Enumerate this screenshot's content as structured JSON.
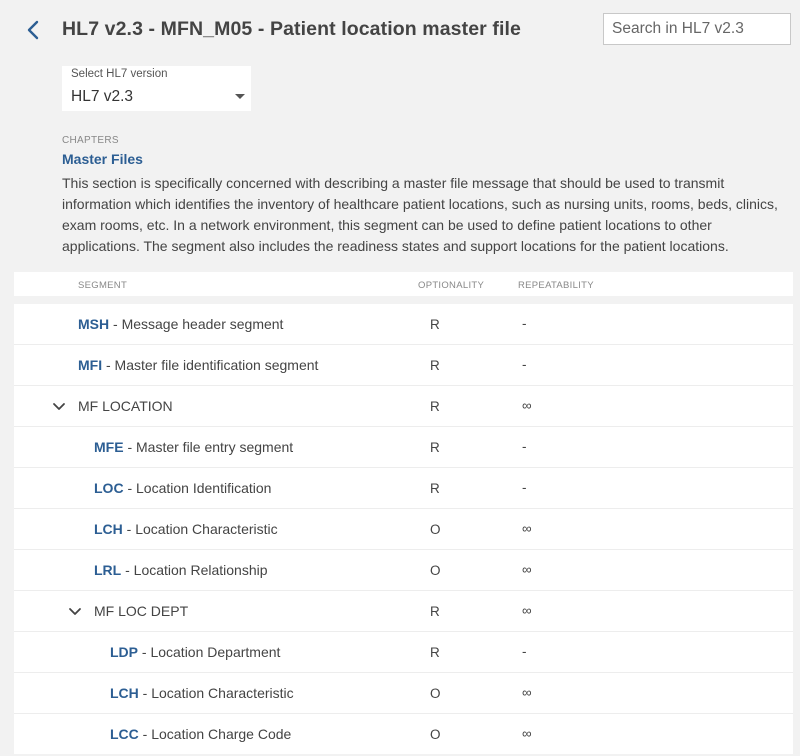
{
  "header": {
    "title": "HL7 v2.3 - MFN_M05 - Patient location master file",
    "back_icon": "chevron-left-icon",
    "search_placeholder": "Search in HL7 v2.3"
  },
  "version_select": {
    "label": "Select HL7 version",
    "value": "HL7 v2.3"
  },
  "chapters": {
    "label": "CHAPTERS",
    "link": "Master Files",
    "description": "This section is specifically concerned with describing a master file message that should be used to transmit information which identifies the inventory of healthcare patient locations, such as nursing units, rooms, beds, clinics, exam rooms, etc. In a network environment, this segment can be used to define patient locations to other applications. The segment also includes the readiness states and support locations for the patient locations."
  },
  "table": {
    "headers": {
      "segment": "SEGMENT",
      "optionality": "OPTIONALITY",
      "repeatability": "REPEATABILITY"
    },
    "rows": [
      {
        "level": 0,
        "group": false,
        "code": "MSH",
        "desc": " - Message header segment",
        "opt": "R",
        "rep": "-"
      },
      {
        "level": 0,
        "group": false,
        "code": "MFI",
        "desc": " - Master file identification segment",
        "opt": "R",
        "rep": "-"
      },
      {
        "level": 0,
        "group": true,
        "name": "MF LOCATION",
        "opt": "R",
        "rep": "∞"
      },
      {
        "level": 1,
        "group": false,
        "code": "MFE",
        "desc": " - Master file entry segment",
        "opt": "R",
        "rep": "-"
      },
      {
        "level": 1,
        "group": false,
        "code": "LOC",
        "desc": " - Location Identification",
        "opt": "R",
        "rep": "-"
      },
      {
        "level": 1,
        "group": false,
        "code": "LCH",
        "desc": " - Location Characteristic",
        "opt": "O",
        "rep": "∞"
      },
      {
        "level": 1,
        "group": false,
        "code": "LRL",
        "desc": " - Location Relationship",
        "opt": "O",
        "rep": "∞"
      },
      {
        "level": 1,
        "group": true,
        "name": "MF LOC DEPT",
        "opt": "R",
        "rep": "∞"
      },
      {
        "level": 2,
        "group": false,
        "code": "LDP",
        "desc": " - Location Department",
        "opt": "R",
        "rep": "-"
      },
      {
        "level": 2,
        "group": false,
        "code": "LCH",
        "desc": " - Location Characteristic",
        "opt": "O",
        "rep": "∞"
      },
      {
        "level": 2,
        "group": false,
        "code": "LCC",
        "desc": " - Location Charge Code",
        "opt": "O",
        "rep": "∞"
      }
    ]
  },
  "colors": {
    "accent": "#2c5e93",
    "background": "#f2f2f2"
  }
}
